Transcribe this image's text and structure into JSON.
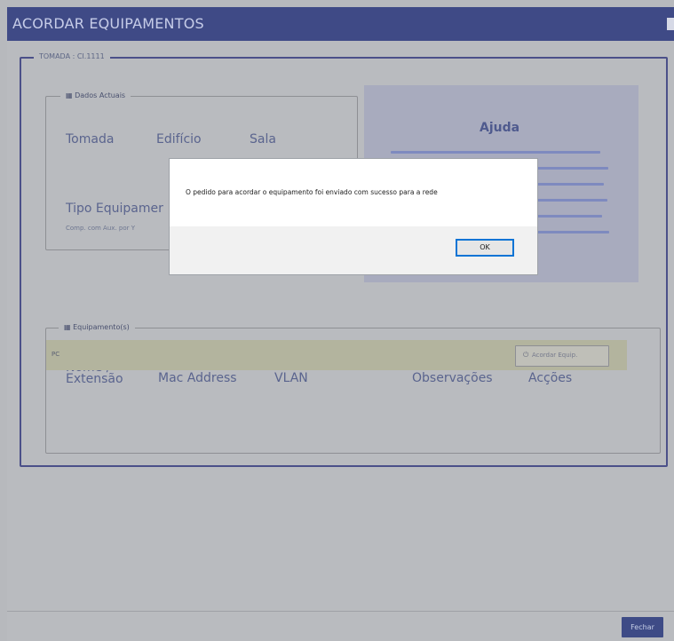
{
  "window": {
    "title": "ACORDAR EQUIPAMENTOS",
    "section_legend": "TOMADA : CI.1111"
  },
  "dados": {
    "legend": "Dados Actuais",
    "tomada_label": "Tomada",
    "edificio_label": "Edifício",
    "sala_label": "Sala",
    "tipo_label": "Tipo Equipamer",
    "tipo_description": "Comp. com Aux. por Y"
  },
  "help": {
    "title": "Ajuda"
  },
  "equipamentos": {
    "legend": "Equipamento(s)",
    "columns": [
      "Nome / Extensão",
      "Mac Address",
      "VLAN",
      "Observações",
      "Acções"
    ],
    "rows": [
      {
        "nome": "PC",
        "action_label": "Acordar Equip."
      }
    ]
  },
  "footer": {
    "close_label": "Fechar"
  },
  "dialog": {
    "message": "O pedido para acordar o equipamento foi enviado com sucesso para a rede",
    "ok_label": "OK"
  },
  "icons": {
    "legend_icon": "table-icon",
    "wake_icon": "power-icon"
  },
  "colors": {
    "titlebar": "#3f4a86",
    "help_bg": "#a8abbe",
    "dialog_focus": "#0a74d5"
  }
}
